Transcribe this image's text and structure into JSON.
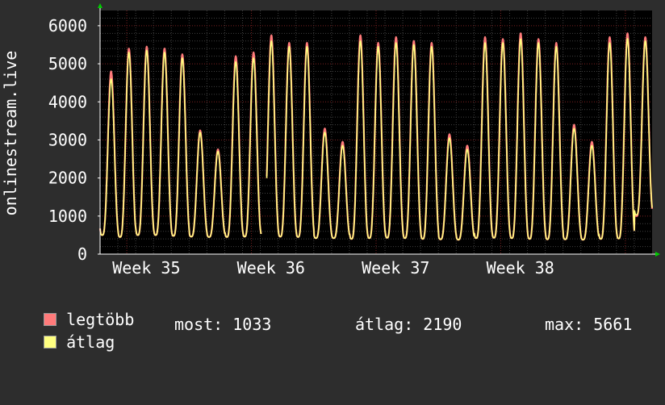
{
  "chart_data": {
    "type": "line",
    "ylabel": "onlinestream.live",
    "ylim": [
      0,
      6400
    ],
    "yticks": [
      0,
      1000,
      2000,
      3000,
      4000,
      5000,
      6000
    ],
    "x_period_labels": [
      "Week 35",
      "Week 36",
      "Week 37",
      "Week 38"
    ],
    "grid": true,
    "colors": {
      "background": "#000000",
      "major_grid": "#7a2020",
      "minor_grid": "#404040",
      "axis": "#ffffff",
      "arrow": "#00cc00"
    },
    "series": [
      {
        "name": "legtöbb",
        "color": "#ff7a7a",
        "daily_peaks": [
          4800,
          5400,
          5450,
          5400,
          5250,
          3250,
          2750,
          5200,
          5300,
          5750,
          5550,
          5550,
          3300,
          2950,
          5750,
          5550,
          5700,
          5600,
          5550,
          3150,
          2850,
          5700,
          5650,
          5800,
          5650,
          5550,
          3400,
          2950,
          5700,
          5800,
          5700
        ],
        "daily_troughs": [
          500,
          450,
          500,
          500,
          480,
          460,
          450,
          450,
          460,
          470,
          460,
          450,
          420,
          420,
          400,
          420,
          430,
          420,
          400,
          390,
          380,
          420,
          430,
          420,
          400,
          390,
          390,
          380,
          400,
          410,
          1000
        ]
      },
      {
        "name": "átlag",
        "color": "#ffff80",
        "daily_peaks": [
          4600,
          5300,
          5350,
          5300,
          5150,
          3200,
          2700,
          5050,
          5150,
          5600,
          5450,
          5450,
          3200,
          2850,
          5600,
          5450,
          5550,
          5500,
          5450,
          3050,
          2750,
          5550,
          5550,
          5650,
          5550,
          5450,
          3300,
          2850,
          5550,
          5661,
          5600
        ],
        "daily_troughs": [
          500,
          450,
          500,
          500,
          480,
          460,
          450,
          450,
          460,
          470,
          460,
          450,
          420,
          420,
          400,
          420,
          430,
          420,
          400,
          390,
          380,
          420,
          430,
          420,
          400,
          390,
          390,
          380,
          400,
          410,
          1033
        ]
      }
    ],
    "legend": [
      {
        "label": "legtöbb",
        "color": "#ff7a7a"
      },
      {
        "label": "átlag",
        "color": "#ffff80"
      }
    ],
    "stats": {
      "now": {
        "label": "most:",
        "value": "1033"
      },
      "avg": {
        "label": "átlag:",
        "value": "2190"
      },
      "max": {
        "label": "max:",
        "value": "5661"
      }
    }
  }
}
